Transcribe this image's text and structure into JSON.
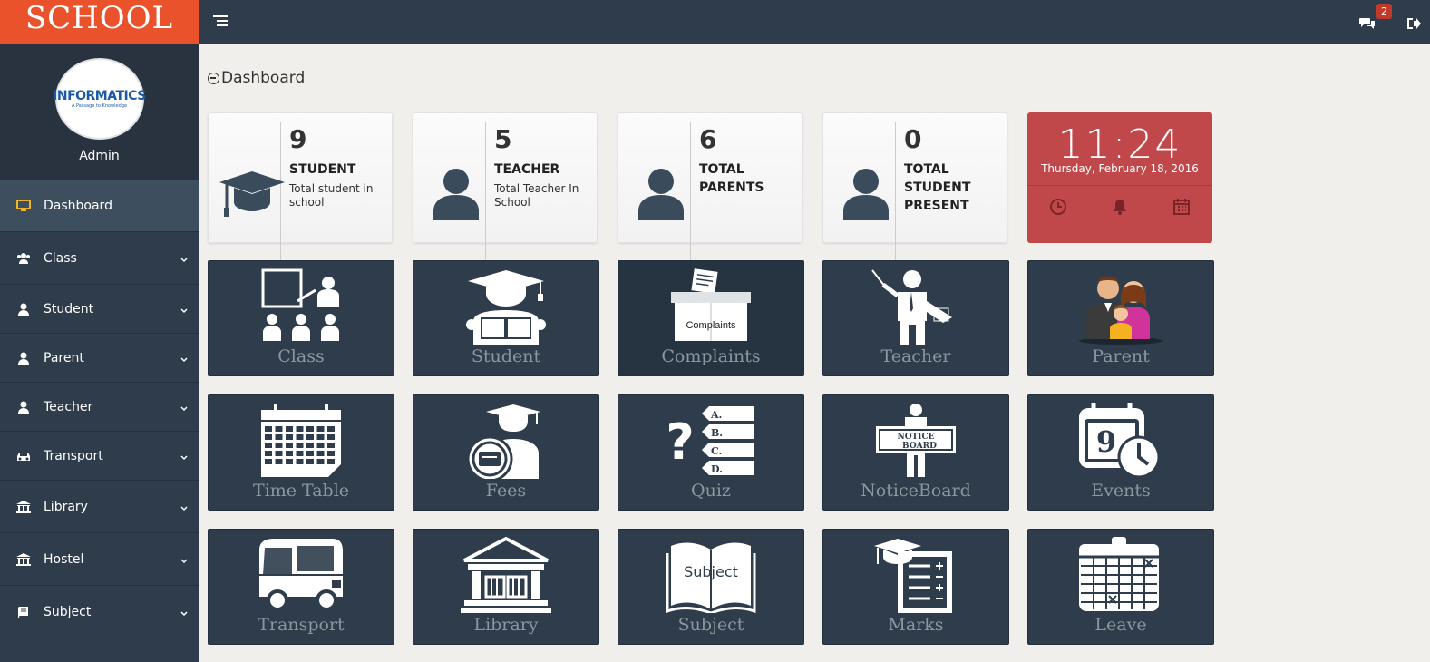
{
  "brand": "SCHOOL",
  "header": {
    "notification_count": "2"
  },
  "sidebar": {
    "profile_logo_text": "INFORMATICS",
    "profile_logo_tagline": "A Passage to Knowledge",
    "profile_name": "Admin",
    "items": [
      {
        "label": "Dashboard",
        "icon": "monitor-icon"
      },
      {
        "label": "Class",
        "icon": "group-icon"
      },
      {
        "label": "Student",
        "icon": "user-icon"
      },
      {
        "label": "Parent",
        "icon": "user-icon"
      },
      {
        "label": "Teacher",
        "icon": "user-icon"
      },
      {
        "label": "Transport",
        "icon": "car-icon"
      },
      {
        "label": "Library",
        "icon": "institution-icon"
      },
      {
        "label": "Hostel",
        "icon": "institution-icon"
      },
      {
        "label": "Subject",
        "icon": "book-icon"
      }
    ]
  },
  "page_title": "Dashboard",
  "stats": [
    {
      "number": "9",
      "label": "STUDENT",
      "sub": "Total student in school"
    },
    {
      "number": "5",
      "label": "TEACHER",
      "sub": "Total Teacher In School"
    },
    {
      "number": "6",
      "label": "TOTAL PARENTS",
      "sub": ""
    },
    {
      "number": "0",
      "label": "TOTAL STUDENT PRESENT",
      "sub": ""
    }
  ],
  "clock": {
    "time": "11:24",
    "date": "Thursday, February 18, 2016"
  },
  "tiles": [
    {
      "label": "Class",
      "icon": "classroom-icon"
    },
    {
      "label": "Student",
      "icon": "graduate-reading-icon"
    },
    {
      "label": "Complaints",
      "icon": "complaint-box-icon",
      "icon_text": "Complaints"
    },
    {
      "label": "Teacher",
      "icon": "teacher-pointer-icon"
    },
    {
      "label": "Parent",
      "icon": "family-icon"
    },
    {
      "label": "Time Table",
      "icon": "calendar-icon"
    },
    {
      "label": "Fees",
      "icon": "fees-graduate-icon"
    },
    {
      "label": "Quiz",
      "icon": "quiz-icon",
      "icon_text": [
        "A.",
        "B.",
        "C.",
        "D."
      ]
    },
    {
      "label": "NoticeBoard",
      "icon": "noticeboard-icon",
      "icon_text": [
        "NOTICE",
        "BOARD"
      ]
    },
    {
      "label": "Events",
      "icon": "events-clock-icon",
      "icon_text": "9"
    },
    {
      "label": "Transport",
      "icon": "bus-icon"
    },
    {
      "label": "Library",
      "icon": "library-building-icon"
    },
    {
      "label": "Subject",
      "icon": "open-book-icon",
      "icon_text": "Subject"
    },
    {
      "label": "Marks",
      "icon": "marks-sheet-icon"
    },
    {
      "label": "Leave",
      "icon": "leave-calendar-icon"
    }
  ],
  "colors": {
    "brand": "#e9522a",
    "navbar": "#2e3c4b",
    "tile": "#2e3c4b",
    "clock": "#c0474a",
    "badge": "#c0392b"
  }
}
